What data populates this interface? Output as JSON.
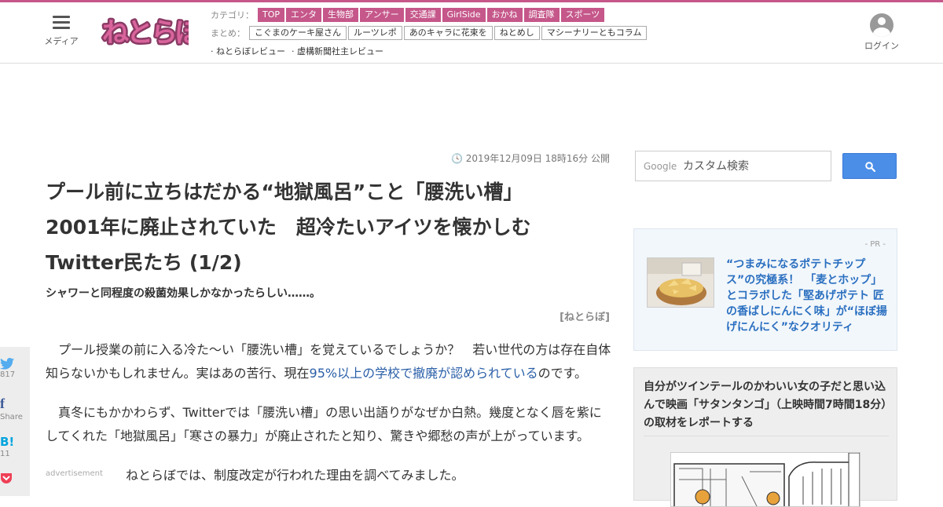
{
  "header": {
    "menu_label": "メディア",
    "logo_text": "ねとらぼ",
    "category_label": "カテゴリ：",
    "categories": [
      "TOP",
      "エンタ",
      "生物部",
      "アンサー",
      "交通課",
      "GirlSide",
      "おかね",
      "調査隊",
      "スポーツ"
    ],
    "matome_label": "まとめ：",
    "matome": [
      "こぐまのケーキ屋さん",
      "ルーツレポ",
      "あのキャラに花束を",
      "ねとめし",
      "マシーナリーともコラム"
    ],
    "reviews": [
      "· ねとらぼレビュー",
      "· 虚構新聞社主レビュー"
    ],
    "login_label": "ログイン"
  },
  "article": {
    "date": "2019年12月09日 18時16分 公開",
    "title_line1": "プール前に立ちはだかる“地獄風呂”こと「腰洗い槽」",
    "title_line2": "2001年に廃止されていた　超冷たいアイツを懐かしむ",
    "title_line3": "Twitter民たち (1/2)",
    "subtitle": "シャワーと同程度の殺菌効果しかなかったらしい……。",
    "source": "[ねとらぼ]",
    "p1_a": "　プール授業の前に入る冷た～い「腰洗い槽」を覚えているでしょうか？　若い世代の方は存在自体知らないかもしれません。実はあの苦行、現在",
    "p1_link": "95%以上の学校で撤廃が認められている",
    "p1_b": "のです。",
    "p2": "　真冬にもかかわらず、Twitterでは「腰洗い槽」の思い出語りがなぜか白熱。幾度となく唇を紫にしてくれた「地獄風呂」「寒さの暴力」が廃止されたと知り、驚きや郷愁の声が上がっています。",
    "advertisement": "advertisement",
    "p3": "ねとらぼでは、制度改定が行われた理由を調べてみました。"
  },
  "share": {
    "twitter_count": "817",
    "facebook_label": "Share",
    "hatena_icon": "B!",
    "hatena_count": "11"
  },
  "sidebar": {
    "search_brand": "Google",
    "search_placeholder": "カスタム検索",
    "pr_tag": "- PR -",
    "pr_text": "“つまみになるポテトチップス”の究極系！　「麦とホップ」とコラボした「堅あげポテト 匠の香ばしにんにく味」が“ほぼ揚げにんにく”なクオリティ",
    "rec_text": "自分がツインテールのかわいい女の子だと思い込んで映画「サタンタンゴ」（上映時間7時間18分）の取材をレポートする"
  },
  "colors": {
    "brand": "#c5578a",
    "link": "#2a5fa8",
    "search_button": "#4a8ee8"
  }
}
